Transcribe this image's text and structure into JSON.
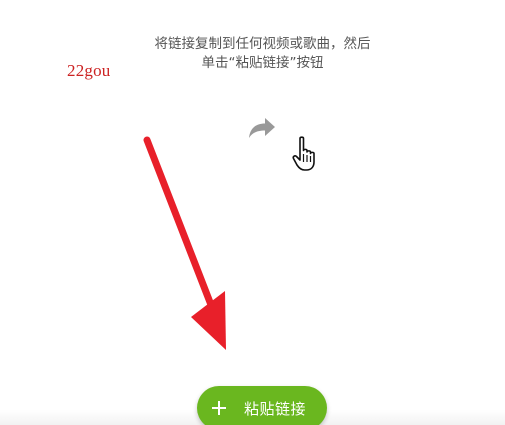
{
  "instruction": {
    "line1": "将链接复制到任何视频或歌曲，然后",
    "line2": "单击“粘贴链接”按钮"
  },
  "watermark": "22gou",
  "icons": {
    "share": "share-arrow-icon",
    "pointer": "hand-pointer-icon",
    "annotation": "red-arrow-annotation"
  },
  "paste_button": {
    "label": "粘贴链接"
  },
  "colors": {
    "accent_green": "#6ab71f",
    "annotation_red": "#e8202a",
    "watermark_red": "#cc2222",
    "instruction_text": "#555555",
    "share_icon_gray": "#999999"
  }
}
